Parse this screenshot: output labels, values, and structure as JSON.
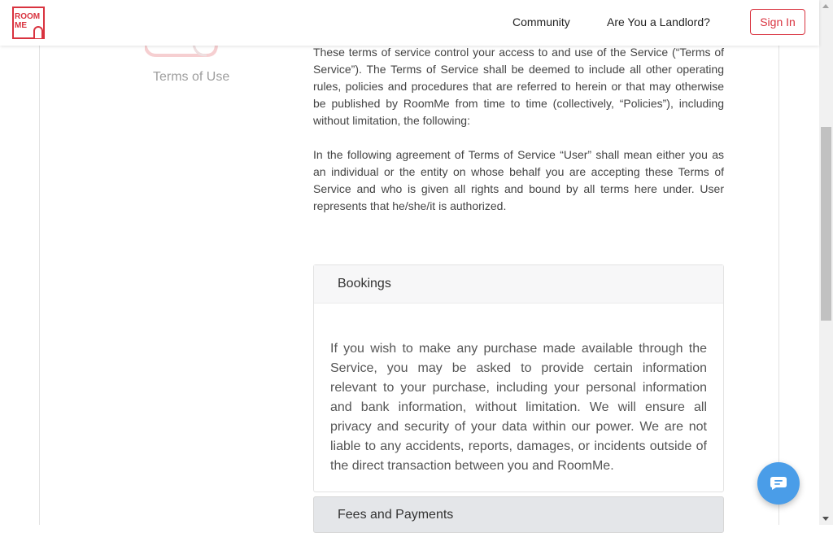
{
  "header": {
    "logo_text_top": "ROOM",
    "logo_text_bottom": "ME",
    "nav": [
      {
        "label": "Community"
      },
      {
        "label": "Are You a Landlord?"
      }
    ],
    "signin_label": "Sign In"
  },
  "sidebar": {
    "title": "Terms of Use"
  },
  "content": {
    "paragraphs": [
      "These terms of service control your access to and use of the Service (“Terms of Service”). The Terms of Service shall be deemed to include all other operating rules, policies and procedures that are referred to herein or that may otherwise be published by RoomMe from time to time (collectively, “Policies”), including without limitation, the following:",
      "In the following agreement of Terms of Service “User” shall mean either you as an individual or the entity on whose behalf you are accepting these Terms of Service and who is given all rights and bound by all terms here under. User represents that he/she/it is authorized."
    ]
  },
  "accordion": [
    {
      "title": "Bookings",
      "body": "If you wish to make any purchase made available through the Service, you may be asked to provide certain information relevant to your purchase, including your personal information and bank information, without limitation. We will ensure all privacy and security of your data within our power. We are not liable to any accidents, reports, damages, or incidents outside of the direct transaction between you and RoomMe.",
      "expanded": true
    },
    {
      "title": "Fees and Payments",
      "expanded": false
    }
  ],
  "chat": {
    "icon": "chat-bubble-icon"
  },
  "colors": {
    "brand_red": "#d9333f",
    "chat_blue": "#4a9de8"
  }
}
